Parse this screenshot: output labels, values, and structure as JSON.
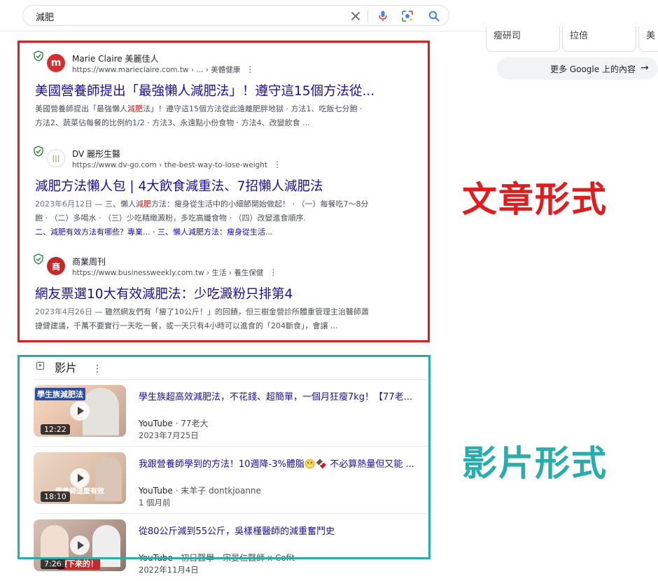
{
  "search": {
    "query": "減肥"
  },
  "right_panel": {
    "cards": [
      "瘦研司",
      "拉倍",
      "美"
    ],
    "more_button": "更多 Google 上的內容"
  },
  "results": [
    {
      "site_name": "Marie Claire 美麗佳人",
      "favicon_text": "m",
      "url": "https://www.marieclaire.com.tw › ... › 美體健康",
      "title": "美國營養師提出「最強懶人減肥法」！遵守這15個方法從...",
      "snippet_line1_a": "美國營養師提出「最強懶人",
      "snippet_line1_hl": "減肥",
      "snippet_line1_b": "法」！遵守這15個方法從此遠離肥胖地獄 · 方法1、吃飯七分飽 ·",
      "snippet_line2": "方法2、蔬菜佔每餐的比例約1/2 · 方法3、永遠點小份食物 · 方法4、改變飲食 ..."
    },
    {
      "site_name": "DV 麗彤生醫",
      "favicon_text": "|||",
      "url": "https://www.dv-go.com › the-best-way-to-lose-weight",
      "title": "減肥方法懶人包 | 4大飲食減重法、7招懶人減肥法",
      "snippet_date": "2023年6月12日",
      "snippet_line1_a": " — 三、懶人",
      "snippet_line1_hl": "減肥",
      "snippet_line1_b": "方法：瘦身從生活中的小細節開始做起！ · （一）每餐吃7～8分",
      "snippet_line2": "飽 · （二）多喝水 · （三）少吃精緻澱粉，多吃高纖食物 · （四）改變進食順序.",
      "sitelinks": "二、減肥有效方法有哪些？專業... · 三、懶人減肥方法：瘦身從生活..."
    },
    {
      "site_name": "商業周刊",
      "favicon_text": "商",
      "url": "https://www.businessweekly.com.tw › 生活 › 養生保健",
      "title": "網友票選10大有效減肥法：少吃澱粉只排第4",
      "snippet_date": "2023年4月26日",
      "snippet_line1_b": " — 雖然網友們有「瘦了10公斤！」的回饋，但三樹金營診所體重管理主治醫師蕭",
      "snippet_line2": "捷健建議，千萬不要實行一天吃一餐，或一天只有4小時可以進食的「204斷食」，會讓 ..."
    }
  ],
  "annotations": {
    "articles": "文章形式",
    "videos": "影片形式"
  },
  "videos_section": {
    "heading": "影片",
    "items": [
      {
        "title": "學生族超高效減肥法，不花錢、超簡單，一個月狂瘦7kg！【77老...",
        "platform": "YouTube",
        "channel": "77老大",
        "date": "2023年7月25日",
        "duration": "12:22",
        "caption": "學生族減肥法"
      },
      {
        "title": "我跟營養師學到的方法！10週降-3%體脂😬🍫 不必算熱量但又能 ...",
        "platform": "YouTube",
        "channel": "末羊子 dontkjoanne",
        "date": "1 個月前",
        "duration": "18:10",
        "caption": "營養師這麼有效"
      },
      {
        "title": "從80公斤減到55公斤，吳樣槿醫師的減重奮鬥史",
        "platform": "YouTube",
        "channel": "初日醫學 - 宋晏仁醫師 x Cofit",
        "date": "2022年11月4日",
        "duration": "7:26",
        "caption": "瘦下來的！"
      }
    ]
  },
  "colors": {
    "link": "#1a0dab",
    "annotation_red": "#e41b1b",
    "annotation_teal": "#26aeaa"
  }
}
